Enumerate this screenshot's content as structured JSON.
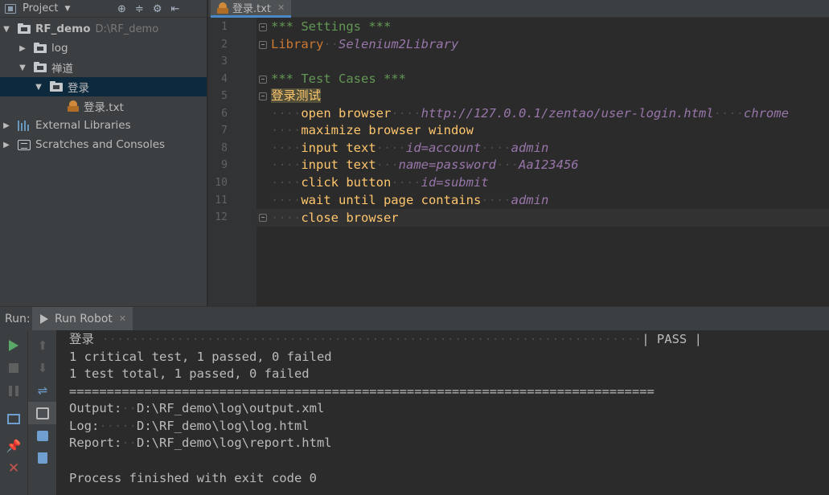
{
  "project_pane": {
    "title": "Project",
    "tree": [
      {
        "label": "RF_demo",
        "path": "D:\\RF_demo"
      },
      {
        "label": "log"
      },
      {
        "label": "禅道"
      },
      {
        "label": "登录"
      },
      {
        "label": "登录.txt"
      },
      {
        "label": "External Libraries"
      },
      {
        "label": "Scratches and Consoles"
      }
    ]
  },
  "editor": {
    "tab": "登录.txt",
    "line_numbers": [
      "1",
      "2",
      "3",
      "4",
      "5",
      "6",
      "7",
      "8",
      "9",
      "10",
      "11",
      "12"
    ],
    "code": {
      "settings_header": "*** Settings ***",
      "library_kw": "Library",
      "library_name": "Selenium2Library",
      "testcases_header": "*** Test Cases ***",
      "test_case_name": "登录测试",
      "l6_kw": "open browser",
      "l6_arg1": "http://127.0.0.1/zentao/user-login.html",
      "l6_arg2": "chrome",
      "l7_kw": "maximize browser window",
      "l8_kw": "input text",
      "l8_arg1": "id=account",
      "l8_arg2": "admin",
      "l9_kw": "input text",
      "l9_arg1": "name=password",
      "l9_arg2": "Aa123456",
      "l10_kw": "click button",
      "l10_arg1": "id=submit",
      "l11_kw": "wait until page contains",
      "l11_arg1": "admin",
      "l12_kw": "close browser"
    }
  },
  "run_panel": {
    "label": "Run:",
    "tab": "Run Robot",
    "console": {
      "l1_name": "登录",
      "l1_status": "| PASS |",
      "l2": "1 critical test, 1 passed, 0 failed",
      "l3": "1 test total, 1 passed, 0 failed",
      "l4": "==============================================================================",
      "l5_label": "Output:",
      "l5_value": "D:\\RF_demo\\log\\output.xml",
      "l6_label": "Log:",
      "l6_value": "D:\\RF_demo\\log\\log.html",
      "l7_label": "Report:",
      "l7_value": "D:\\RF_demo\\log\\report.html",
      "l8": "Process finished with exit code 0"
    }
  },
  "colors": {
    "background": "#2b2b2b",
    "panel": "#3c3f41",
    "selection": "#0d293e",
    "header_green": "#629755",
    "keyword_orange": "#cc7832",
    "variable_purple": "#9876aa",
    "call_yellow": "#ffc66d"
  }
}
